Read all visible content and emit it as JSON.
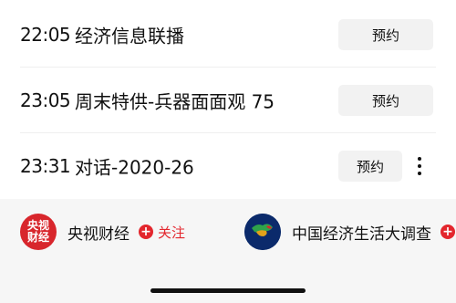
{
  "schedule": [
    {
      "time": "22:05",
      "title": "经济信息联播",
      "button": "预约",
      "has_more": false
    },
    {
      "time": "23:05",
      "title": "周末特供-兵器面面观 75",
      "button": "预约",
      "has_more": false
    },
    {
      "time": "23:31",
      "title": "对话-2020-26",
      "button": "预约",
      "has_more": true
    }
  ],
  "channels": [
    {
      "logo_text_top": "央视",
      "logo_text_bottom": "财经",
      "name": "央视财经",
      "follow_icon": "plus-icon",
      "follow_label": "关注",
      "logo_color": "#d8262c"
    },
    {
      "logo_text": "中国经济生活大调查",
      "name": "中国经济生活大调查",
      "follow_icon": "plus-icon",
      "logo_color": "#0b2a6b"
    }
  ],
  "colors": {
    "accent": "#e3262d",
    "button_bg": "#f2f2f2",
    "footer_bg": "#f6f6f6"
  }
}
